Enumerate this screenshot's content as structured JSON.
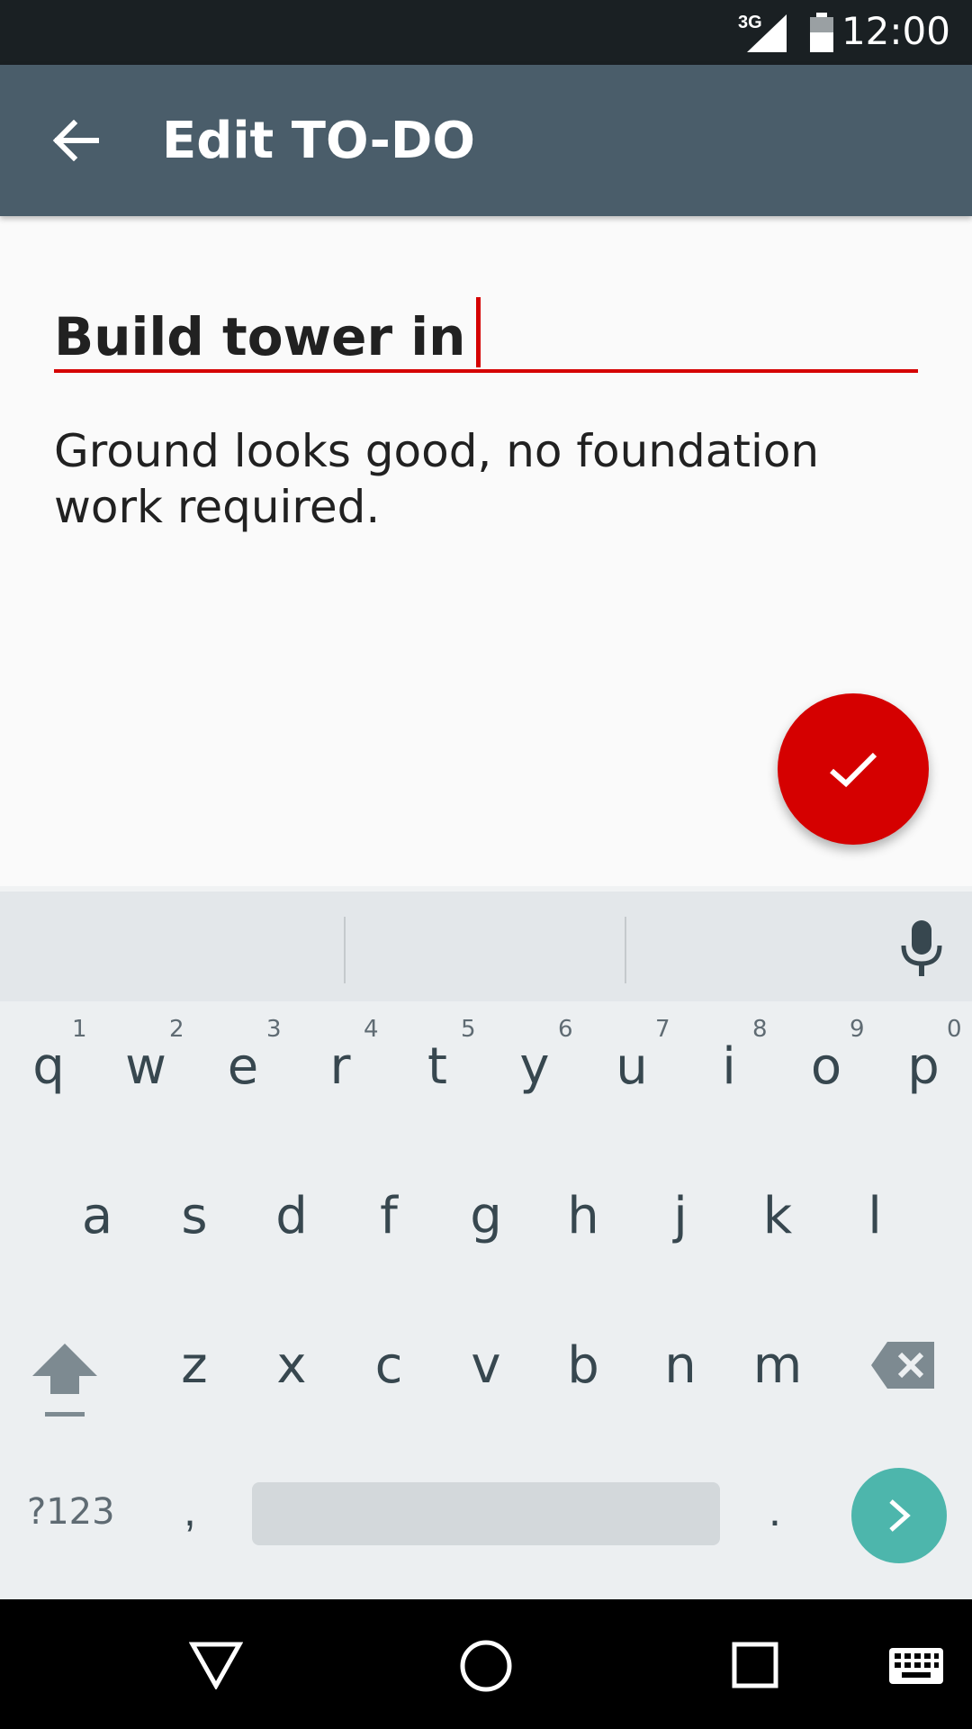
{
  "status_bar": {
    "network": "3G",
    "time": "12:00"
  },
  "app_bar": {
    "title": "Edit TO-DO"
  },
  "form": {
    "title_value": "Build tower in",
    "description_value": "Ground looks good, no foundation work required."
  },
  "keyboard": {
    "row1": [
      "q",
      "w",
      "e",
      "r",
      "t",
      "y",
      "u",
      "i",
      "o",
      "p"
    ],
    "row1_numbers": [
      "1",
      "2",
      "3",
      "4",
      "5",
      "6",
      "7",
      "8",
      "9",
      "0"
    ],
    "row2": [
      "a",
      "s",
      "d",
      "f",
      "g",
      "h",
      "j",
      "k",
      "l"
    ],
    "row3": [
      "z",
      "x",
      "c",
      "v",
      "b",
      "n",
      "m"
    ],
    "symbols_label": "?123",
    "comma": ",",
    "period": "."
  },
  "colors": {
    "accent": "#d50000",
    "app_bar": "#4a5d6a",
    "enter": "#4db6ac"
  }
}
